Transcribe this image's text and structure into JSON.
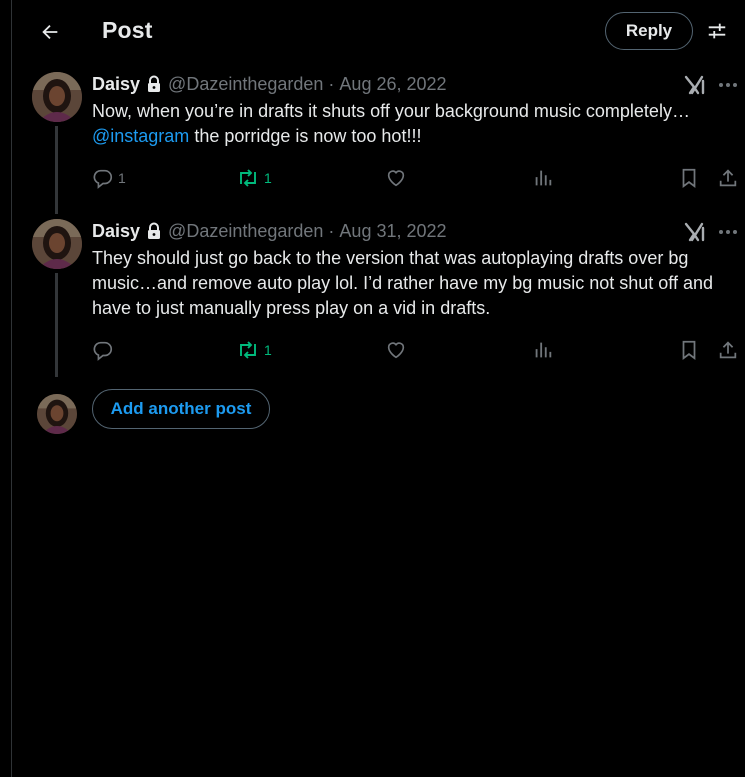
{
  "header": {
    "title": "Post",
    "reply_label": "Reply"
  },
  "colors": {
    "background": "#000000",
    "text": "#e7e9ea",
    "muted": "#71767b",
    "accent_blue": "#1d9bf0",
    "repost_green": "#00ba7c"
  },
  "posts": [
    {
      "name": "Daisy",
      "handle": "@Dazeinthegarden",
      "separator": "·",
      "date": "Aug 26, 2022",
      "text_line1": "Now, when you’re in drafts it shuts off your background music completely…",
      "mention": "@instagram",
      "text_line2_rest": " the porridge is now too hot!!!",
      "reply_count": "1",
      "repost_count": "1"
    },
    {
      "name": "Daisy",
      "handle": "@Dazeinthegarden",
      "separator": "·",
      "date": "Aug 31, 2022",
      "text": "They should just go back to the version that was autoplaying drafts over bg music…and remove auto play lol. I’d rather have my bg music not shut off and have to just manually press play on a vid in drafts.",
      "reply_count": "",
      "repost_count": "1"
    }
  ],
  "compose": {
    "add_post_label": "Add another post"
  },
  "icons": [
    "back-arrow-icon",
    "settings-sliders-icon",
    "lock-icon",
    "grok-icon",
    "more-icon",
    "reply-icon",
    "repost-icon",
    "like-icon",
    "views-icon",
    "bookmark-icon",
    "share-icon"
  ]
}
